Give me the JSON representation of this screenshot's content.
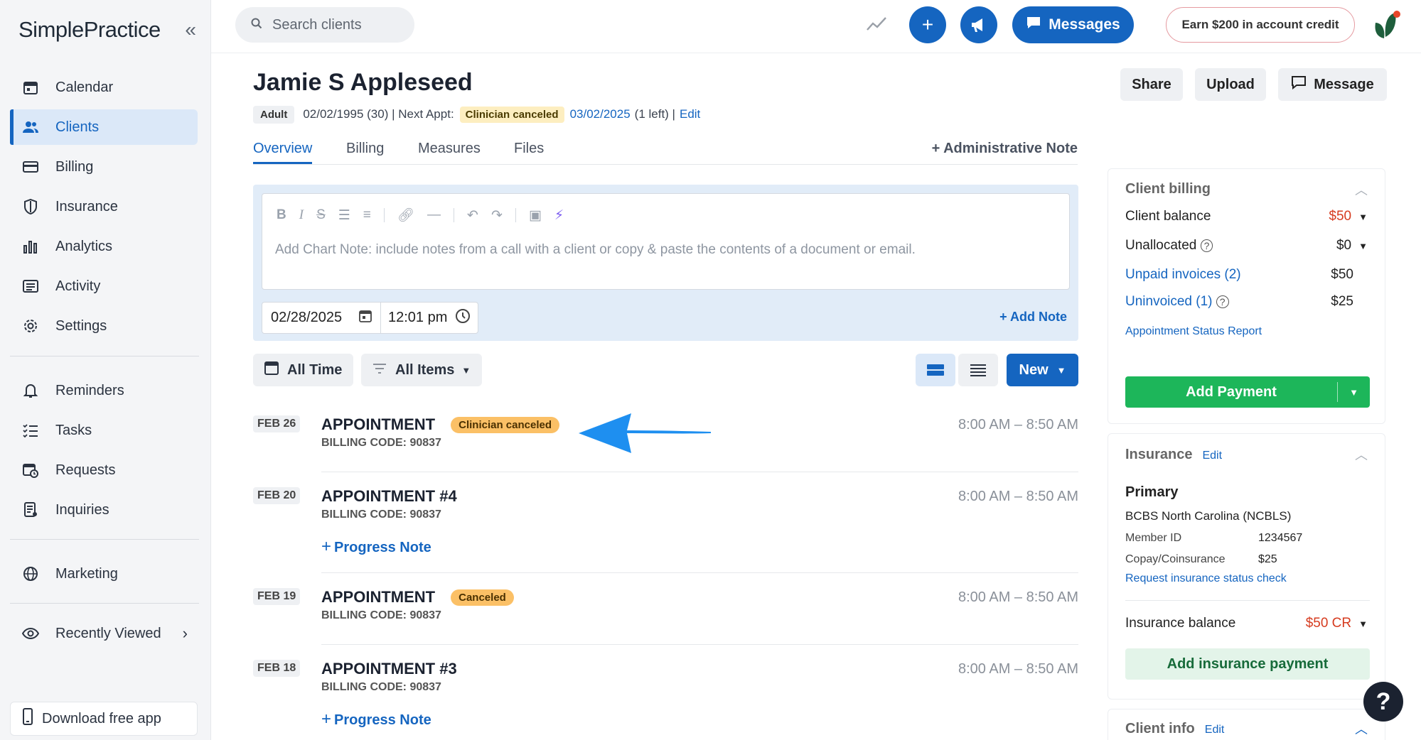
{
  "app": {
    "logo": "SimplePractice"
  },
  "sidebar": {
    "items": [
      {
        "label": "Calendar",
        "icon": "calendar-icon"
      },
      {
        "label": "Clients",
        "icon": "users-icon",
        "active": true
      },
      {
        "label": "Billing",
        "icon": "credit-card-icon"
      },
      {
        "label": "Insurance",
        "icon": "shield-icon"
      },
      {
        "label": "Analytics",
        "icon": "bar-chart-icon"
      },
      {
        "label": "Activity",
        "icon": "list-icon"
      },
      {
        "label": "Settings",
        "icon": "gear-icon"
      },
      {
        "label": "Reminders",
        "icon": "bell-icon"
      },
      {
        "label": "Tasks",
        "icon": "checklist-icon"
      },
      {
        "label": "Requests",
        "icon": "calendar-clock-icon"
      },
      {
        "label": "Inquiries",
        "icon": "document-icon"
      },
      {
        "label": "Marketing",
        "icon": "globe-icon"
      },
      {
        "label": "Recently Viewed",
        "icon": "eye-icon"
      }
    ],
    "download_app": "Download free app"
  },
  "topbar": {
    "search_placeholder": "Search clients",
    "messages_label": "Messages",
    "credit_label": "Earn $200 in account credit"
  },
  "client": {
    "name": "Jamie S Appleseed",
    "type_badge": "Adult",
    "dob_age": "02/02/1995 (30) | Next Appt:",
    "next_status": "Clinician canceled",
    "next_date": "03/02/2025",
    "left_text": "(1 left) |",
    "edit": "Edit"
  },
  "header_buttons": {
    "share": "Share",
    "upload": "Upload",
    "message": "Message"
  },
  "tabs": [
    "Overview",
    "Billing",
    "Measures",
    "Files"
  ],
  "admin_note": "+ Administrative Note",
  "note_editor": {
    "placeholder": "Add Chart Note: include notes from a call with a client or copy & paste the contents of a document or email.",
    "date": "02/28/2025",
    "time": "12:01 pm",
    "add_note": "+ Add Note"
  },
  "filters": {
    "time": "All Time",
    "items": "All Items",
    "new": "New"
  },
  "appointments": [
    {
      "date": "FEB 26",
      "title": "APPOINTMENT",
      "status": "Clinician canceled",
      "code": "BILLING CODE: 90837",
      "time": "8:00 AM – 8:50 AM"
    },
    {
      "date": "FEB 20",
      "title": "APPOINTMENT #4",
      "code": "BILLING CODE: 90837",
      "time": "8:00 AM – 8:50 AM",
      "progress": "Progress Note"
    },
    {
      "date": "FEB 19",
      "title": "APPOINTMENT",
      "status": "Canceled",
      "code": "BILLING CODE: 90837",
      "time": "8:00 AM – 8:50 AM"
    },
    {
      "date": "FEB 18",
      "title": "APPOINTMENT #3",
      "code": "BILLING CODE: 90837",
      "time": "8:00 AM – 8:50 AM",
      "progress": "Progress Note"
    }
  ],
  "billing": {
    "title": "Client billing",
    "client_balance_label": "Client balance",
    "client_balance": "$50",
    "unallocated_label": "Unallocated",
    "unallocated": "$0",
    "unpaid_label": "Unpaid invoices (2)",
    "unpaid": "$50",
    "uninvoiced_label": "Uninvoiced (1)",
    "uninvoiced": "$25",
    "status_report": "Appointment Status Report",
    "add_payment": "Add Payment"
  },
  "insurance": {
    "title": "Insurance",
    "edit": "Edit",
    "primary": "Primary",
    "payer": "BCBS North Carolina (NCBLS)",
    "member_label": "Member ID",
    "member_id": "1234567",
    "copay_label": "Copay/Coinsurance",
    "copay": "$25",
    "status_check": "Request insurance status check",
    "balance_label": "Insurance balance",
    "balance": "$50 CR",
    "add_payment": "Add insurance payment"
  },
  "client_info": {
    "title": "Client info",
    "edit": "Edit"
  },
  "help": "?",
  "colors": {
    "brand_blue": "#1565c0",
    "success_green": "#1db65a",
    "status_orange": "#fbc066",
    "annotation_arrow": "#1e8ff0"
  }
}
